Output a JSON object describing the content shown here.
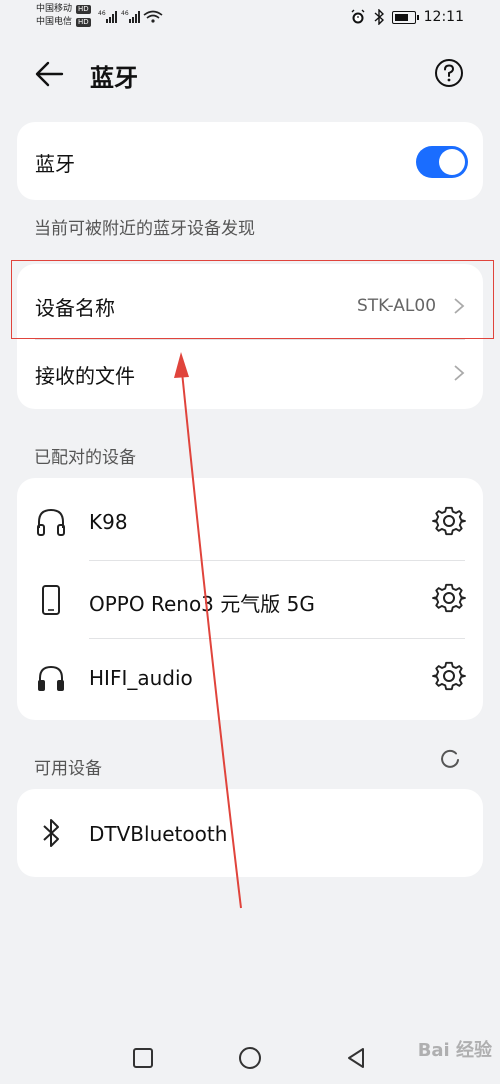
{
  "status": {
    "carrier1": "中国移动",
    "carrier2": "中国电信",
    "hd": "HD",
    "net": "4G",
    "time": "12:11",
    "battery_level": 0.8
  },
  "header": {
    "title": "蓝牙"
  },
  "bluetooth_toggle": {
    "label": "蓝牙",
    "on": true,
    "color": "#1a6dff"
  },
  "visibility_note": "当前可被附近的蓝牙设备发现",
  "device_name": {
    "label": "设备名称",
    "value": "STK-AL00"
  },
  "received_files": {
    "label": "接收的文件"
  },
  "paired_section": {
    "header": "已配对的设备",
    "devices": [
      {
        "name": "K98",
        "icon": "headphones-icon"
      },
      {
        "name": "OPPO Reno3 元气版 5G",
        "icon": "phone-icon"
      },
      {
        "name": "HIFI_audio",
        "icon": "headset-icon"
      }
    ]
  },
  "available_section": {
    "header": "可用设备",
    "devices": [
      {
        "name": "DTVBluetooth",
        "icon": "bluetooth-icon"
      }
    ]
  },
  "annotation": {
    "color": "#e0443c"
  },
  "watermark": "Bai 经验"
}
